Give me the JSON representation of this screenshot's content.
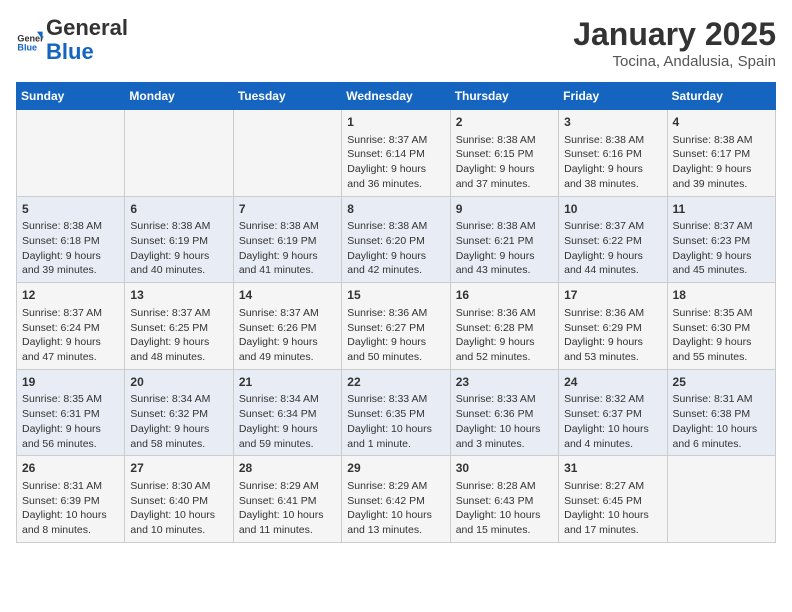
{
  "header": {
    "logo_general": "General",
    "logo_blue": "Blue",
    "title": "January 2025",
    "subtitle": "Tocina, Andalusia, Spain"
  },
  "days_of_week": [
    "Sunday",
    "Monday",
    "Tuesday",
    "Wednesday",
    "Thursday",
    "Friday",
    "Saturday"
  ],
  "weeks": [
    [
      {
        "day": "",
        "info": ""
      },
      {
        "day": "",
        "info": ""
      },
      {
        "day": "",
        "info": ""
      },
      {
        "day": "1",
        "info": "Sunrise: 8:37 AM\nSunset: 6:14 PM\nDaylight: 9 hours and 36 minutes."
      },
      {
        "day": "2",
        "info": "Sunrise: 8:38 AM\nSunset: 6:15 PM\nDaylight: 9 hours and 37 minutes."
      },
      {
        "day": "3",
        "info": "Sunrise: 8:38 AM\nSunset: 6:16 PM\nDaylight: 9 hours and 38 minutes."
      },
      {
        "day": "4",
        "info": "Sunrise: 8:38 AM\nSunset: 6:17 PM\nDaylight: 9 hours and 39 minutes."
      }
    ],
    [
      {
        "day": "5",
        "info": "Sunrise: 8:38 AM\nSunset: 6:18 PM\nDaylight: 9 hours and 39 minutes."
      },
      {
        "day": "6",
        "info": "Sunrise: 8:38 AM\nSunset: 6:19 PM\nDaylight: 9 hours and 40 minutes."
      },
      {
        "day": "7",
        "info": "Sunrise: 8:38 AM\nSunset: 6:19 PM\nDaylight: 9 hours and 41 minutes."
      },
      {
        "day": "8",
        "info": "Sunrise: 8:38 AM\nSunset: 6:20 PM\nDaylight: 9 hours and 42 minutes."
      },
      {
        "day": "9",
        "info": "Sunrise: 8:38 AM\nSunset: 6:21 PM\nDaylight: 9 hours and 43 minutes."
      },
      {
        "day": "10",
        "info": "Sunrise: 8:37 AM\nSunset: 6:22 PM\nDaylight: 9 hours and 44 minutes."
      },
      {
        "day": "11",
        "info": "Sunrise: 8:37 AM\nSunset: 6:23 PM\nDaylight: 9 hours and 45 minutes."
      }
    ],
    [
      {
        "day": "12",
        "info": "Sunrise: 8:37 AM\nSunset: 6:24 PM\nDaylight: 9 hours and 47 minutes."
      },
      {
        "day": "13",
        "info": "Sunrise: 8:37 AM\nSunset: 6:25 PM\nDaylight: 9 hours and 48 minutes."
      },
      {
        "day": "14",
        "info": "Sunrise: 8:37 AM\nSunset: 6:26 PM\nDaylight: 9 hours and 49 minutes."
      },
      {
        "day": "15",
        "info": "Sunrise: 8:36 AM\nSunset: 6:27 PM\nDaylight: 9 hours and 50 minutes."
      },
      {
        "day": "16",
        "info": "Sunrise: 8:36 AM\nSunset: 6:28 PM\nDaylight: 9 hours and 52 minutes."
      },
      {
        "day": "17",
        "info": "Sunrise: 8:36 AM\nSunset: 6:29 PM\nDaylight: 9 hours and 53 minutes."
      },
      {
        "day": "18",
        "info": "Sunrise: 8:35 AM\nSunset: 6:30 PM\nDaylight: 9 hours and 55 minutes."
      }
    ],
    [
      {
        "day": "19",
        "info": "Sunrise: 8:35 AM\nSunset: 6:31 PM\nDaylight: 9 hours and 56 minutes."
      },
      {
        "day": "20",
        "info": "Sunrise: 8:34 AM\nSunset: 6:32 PM\nDaylight: 9 hours and 58 minutes."
      },
      {
        "day": "21",
        "info": "Sunrise: 8:34 AM\nSunset: 6:34 PM\nDaylight: 9 hours and 59 minutes."
      },
      {
        "day": "22",
        "info": "Sunrise: 8:33 AM\nSunset: 6:35 PM\nDaylight: 10 hours and 1 minute."
      },
      {
        "day": "23",
        "info": "Sunrise: 8:33 AM\nSunset: 6:36 PM\nDaylight: 10 hours and 3 minutes."
      },
      {
        "day": "24",
        "info": "Sunrise: 8:32 AM\nSunset: 6:37 PM\nDaylight: 10 hours and 4 minutes."
      },
      {
        "day": "25",
        "info": "Sunrise: 8:31 AM\nSunset: 6:38 PM\nDaylight: 10 hours and 6 minutes."
      }
    ],
    [
      {
        "day": "26",
        "info": "Sunrise: 8:31 AM\nSunset: 6:39 PM\nDaylight: 10 hours and 8 minutes."
      },
      {
        "day": "27",
        "info": "Sunrise: 8:30 AM\nSunset: 6:40 PM\nDaylight: 10 hours and 10 minutes."
      },
      {
        "day": "28",
        "info": "Sunrise: 8:29 AM\nSunset: 6:41 PM\nDaylight: 10 hours and 11 minutes."
      },
      {
        "day": "29",
        "info": "Sunrise: 8:29 AM\nSunset: 6:42 PM\nDaylight: 10 hours and 13 minutes."
      },
      {
        "day": "30",
        "info": "Sunrise: 8:28 AM\nSunset: 6:43 PM\nDaylight: 10 hours and 15 minutes."
      },
      {
        "day": "31",
        "info": "Sunrise: 8:27 AM\nSunset: 6:45 PM\nDaylight: 10 hours and 17 minutes."
      },
      {
        "day": "",
        "info": ""
      }
    ]
  ]
}
